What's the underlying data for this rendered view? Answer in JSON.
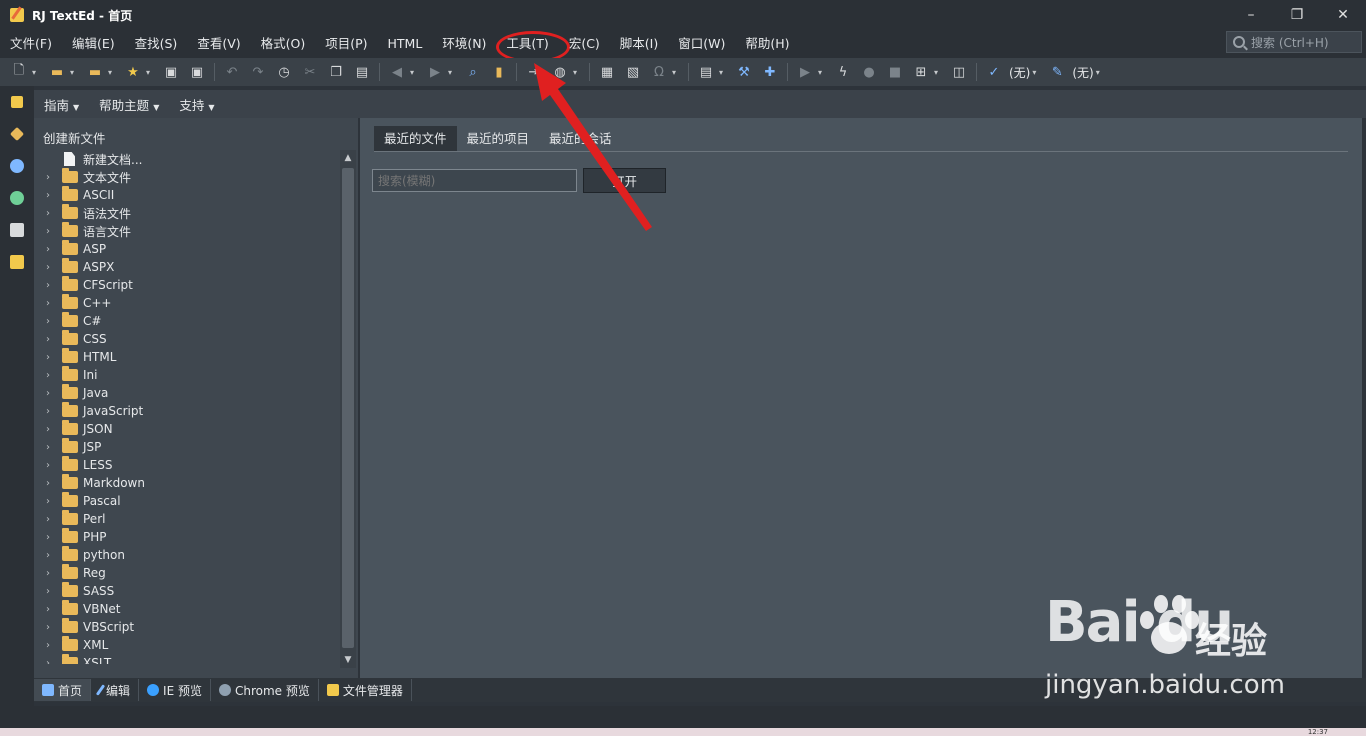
{
  "window": {
    "title": "RJ TextEd - 首页",
    "controls": [
      "–",
      "❐",
      "✕"
    ]
  },
  "menubar": {
    "items": [
      "文件(F)",
      "编辑(E)",
      "查找(S)",
      "查看(V)",
      "格式(O)",
      "项目(P)",
      "HTML",
      "环境(N)",
      "工具(T)",
      "宏(C)",
      "脚本(I)",
      "窗口(W)",
      "帮助(H)"
    ],
    "search_placeholder": "搜索 (Ctrl+H)"
  },
  "toolbar": {
    "spell_none": "(无)",
    "style_none": "(无)"
  },
  "subtoolbar": {
    "items": [
      "指南",
      "帮助主题",
      "支持"
    ]
  },
  "leftpanel": {
    "title": "创建新文件",
    "new_doc": "新建文档...",
    "folders": [
      "文本文件",
      "ASCII",
      "语法文件",
      "语言文件",
      "ASP",
      "ASPX",
      "CFScript",
      "C++",
      "C#",
      "CSS",
      "HTML",
      "Ini",
      "Java",
      "JavaScript",
      "JSON",
      "JSP",
      "LESS",
      "Markdown",
      "Pascal",
      "Perl",
      "PHP",
      "python",
      "Reg",
      "SASS",
      "VBNet",
      "VBScript",
      "XML",
      "XSLT"
    ]
  },
  "main": {
    "tabs": [
      "最近的文件",
      "最近的项目",
      "最近的会话"
    ],
    "filter_placeholder": "搜索(模糊)",
    "open_label": "打开"
  },
  "bottomtabs": [
    "首页",
    "编辑",
    "IE 预览",
    "Chrome 预览",
    "文件管理器"
  ],
  "taskbar": {
    "time": "12:37"
  },
  "watermark": {
    "logo": "Bai du",
    "cn": "经验",
    "url": "jingyan.baidu.com"
  },
  "colors": {
    "accent_red": "#e02020",
    "folder": "#e9b95a",
    "panel": "#3f474f",
    "main": "#4a545d"
  }
}
